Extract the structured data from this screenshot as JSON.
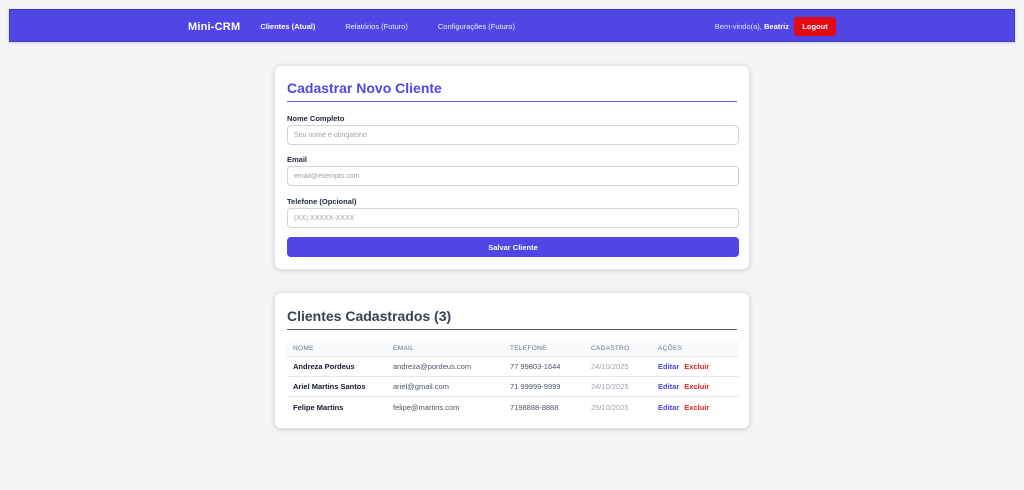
{
  "nav": {
    "brand": "Mini-CRM",
    "links": [
      {
        "label": "Clientes (Atual)"
      },
      {
        "label": "Relatórios (Futuro)"
      },
      {
        "label": "Configurações (Futuro)"
      }
    ],
    "welcome_prefix": "Bem-vindo(a),",
    "user_name": "Beatriz",
    "logout_label": "Logout"
  },
  "form": {
    "title": "Cadastrar Novo Cliente",
    "name_label": "Nome Completo",
    "name_placeholder": "Seu nome é obrigatório",
    "email_label": "Email",
    "email_placeholder": "email@exemplo.com",
    "phone_label": "Telefone (Opcional)",
    "phone_placeholder": "(XX) XXXXX-XXXX",
    "submit_label": "Salvar Cliente"
  },
  "list": {
    "title": "Clientes Cadastrados (3)",
    "columns": {
      "name": "NOME",
      "email": "EMAIL",
      "phone": "TELEFONE",
      "date": "CADASTRO",
      "actions": "AÇÕES"
    },
    "edit_label": "Editar",
    "delete_label": "Excluir",
    "rows": [
      {
        "name": "Andreza Pordeus",
        "email": "andreza@pordeus.com",
        "phone": "77 99803-1644",
        "date": "24/10/2025"
      },
      {
        "name": "Ariel Martins Santos",
        "email": "ariel@gmail.com",
        "phone": "71 99999-9999",
        "date": "24/10/2025"
      },
      {
        "name": "Felipe Martins",
        "email": "felipe@martins.com",
        "phone": "7198888-8888",
        "date": "25/10/2025"
      }
    ]
  },
  "colors": {
    "primary": "#4f46e5",
    "danger": "#dc2626",
    "logout": "#e50914"
  }
}
